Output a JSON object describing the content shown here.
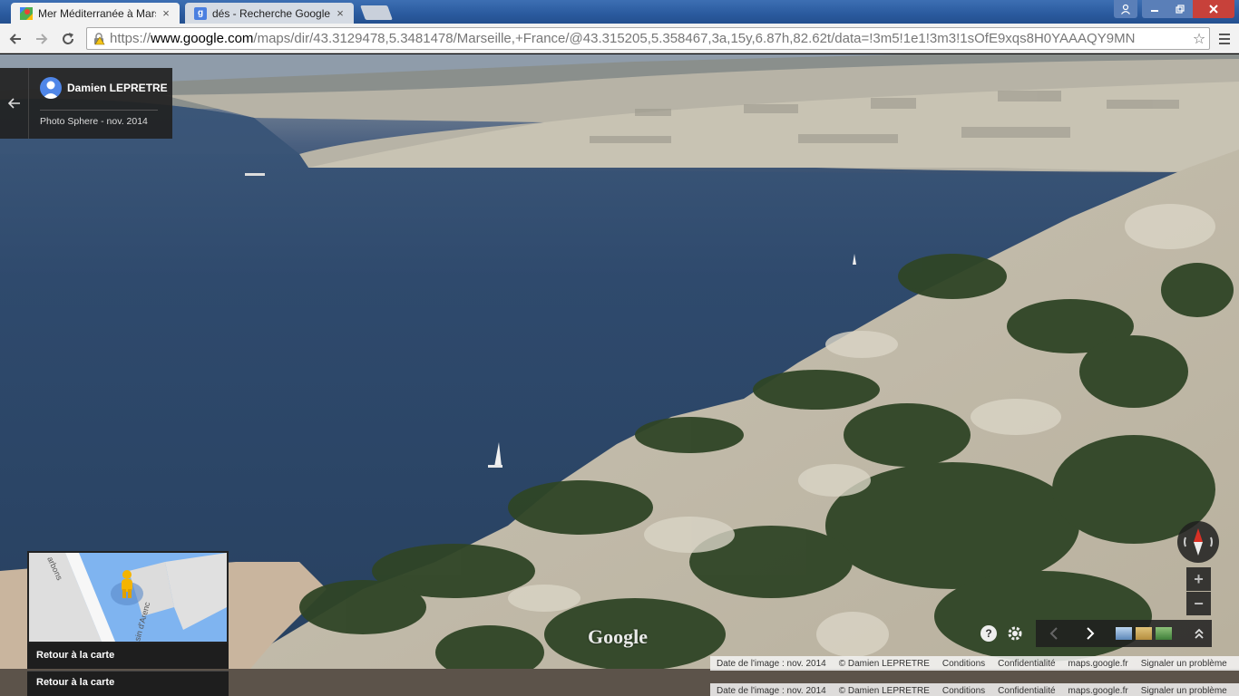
{
  "tabs": [
    {
      "label": "Mer Méditerranée à Marse",
      "close": "×"
    },
    {
      "label": "dés - Recherche Google",
      "close": "×"
    }
  ],
  "toolbar": {
    "url_scheme": "https://",
    "url_domain": "www.google.com",
    "url_path": "/maps/dir/43.3129478,5.3481478/Marseille,+France/@43.315205,5.358467,3a,15y,6.87h,82.62t/data=!3m5!1e1!3m3!1sOfE9xqs8H0YAAAQY9MN"
  },
  "info_card": {
    "author": "Damien LEPRETRE",
    "subtitle": "Photo Sphere - nov. 2014"
  },
  "minimap": {
    "caption": "Retour à la carte",
    "caption_duplicate": "Retour à la carte",
    "street_label_1": "arbons",
    "street_label_2": "sin d'Arenc"
  },
  "watermark": "Google",
  "footer": {
    "image_date": "Date de l'image : nov. 2014",
    "copyright": "© Damien LEPRETRE",
    "terms": "Conditions",
    "privacy": "Confidentialité",
    "domain": "maps.google.fr",
    "report": "Signaler un problème"
  },
  "controls": {
    "zoom_in": "+",
    "zoom_out": "−",
    "help": "?"
  },
  "colors": {
    "accent_blue": "#4f86e8",
    "close_red": "#c7413a",
    "compass_red": "#d93025"
  }
}
